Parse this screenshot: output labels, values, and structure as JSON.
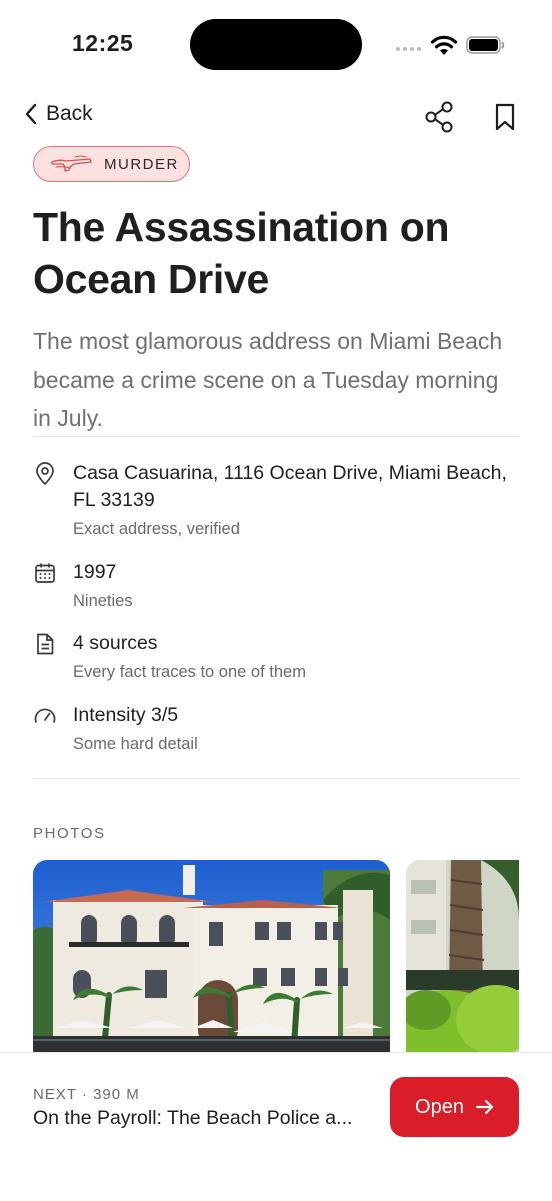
{
  "status_bar": {
    "time": "12:25"
  },
  "nav": {
    "back_label": "Back"
  },
  "tag": {
    "label": "MURDER",
    "icon": "gun-icon",
    "color": "#e57373"
  },
  "title": "The Assassination on Ocean Drive",
  "subtitle": "The most glamorous address on Miami Beach became a crime scene on a Tuesday morning in July.",
  "meta": {
    "location": {
      "primary": "Casa Casuarina, 1116 Ocean Drive, Miami Beach, FL 33139",
      "secondary": "Exact address, verified",
      "icon": "map-pin-icon"
    },
    "date": {
      "primary": "1997",
      "secondary": "Nineties",
      "icon": "calendar-icon"
    },
    "sources": {
      "primary": "4 sources",
      "secondary": "Every fact traces to one of them",
      "icon": "document-icon"
    },
    "intensity": {
      "primary": "Intensity 3/5",
      "secondary": "Some hard detail",
      "icon": "gauge-icon",
      "level": 0.6
    }
  },
  "photos": {
    "label": "PHOTOS"
  },
  "next": {
    "meta": "NEXT · 390 M",
    "title": "On the Payroll: The Beach Police a...",
    "open_label": "Open"
  },
  "colors": {
    "accent": "#d91e2a",
    "tag_bg": "#fde1e1"
  }
}
